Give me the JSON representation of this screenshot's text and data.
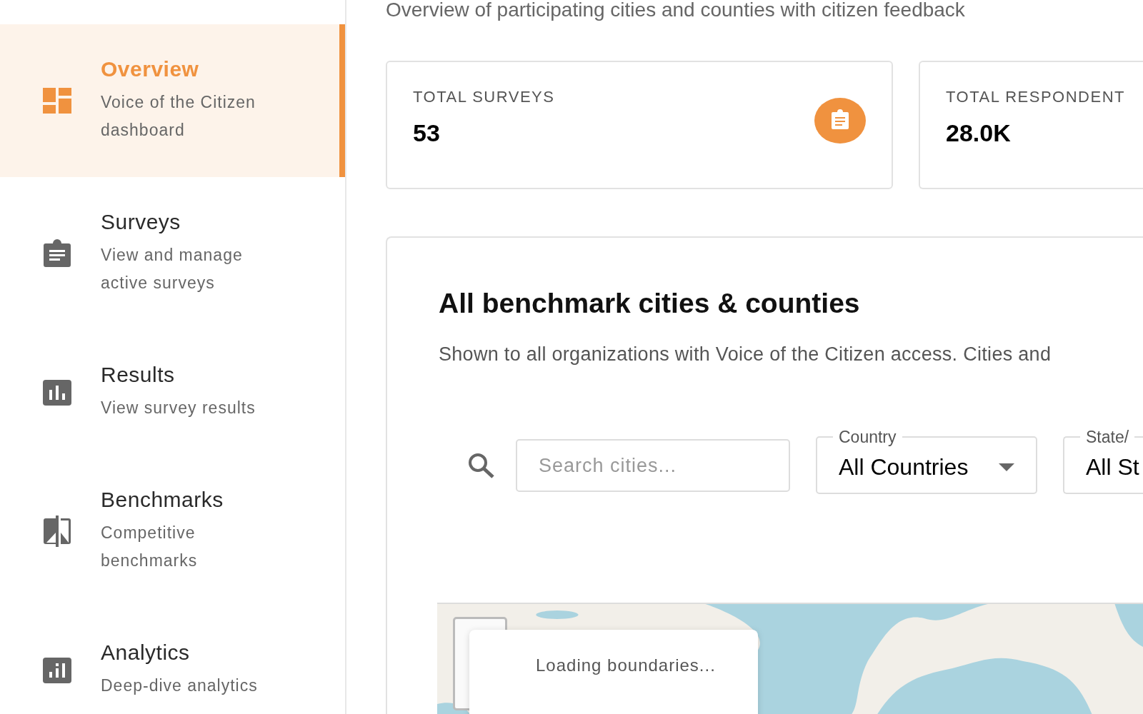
{
  "sidebar": {
    "items": [
      {
        "kind": "dashboard",
        "title": "Overview",
        "subtitle": "Voice of the Citizen dashboard",
        "selected": true
      },
      {
        "kind": "clipboard",
        "title": "Surveys",
        "subtitle": "View and manage active surveys",
        "selected": false
      },
      {
        "kind": "bars",
        "title": "Results",
        "subtitle": "View survey results",
        "selected": false
      },
      {
        "kind": "compare",
        "title": "Benchmarks",
        "subtitle": "Competitive benchmarks",
        "selected": false
      },
      {
        "kind": "analytics",
        "title": "Analytics",
        "subtitle": "Deep-dive analytics",
        "selected": false
      }
    ]
  },
  "page": {
    "subtitle": "Overview of participating cities and counties with citizen feedback"
  },
  "stats": [
    {
      "label": "TOTAL SURVEYS",
      "value": "53",
      "icon": true
    },
    {
      "label": "TOTAL RESPONDENT",
      "value": "28.0K",
      "icon": false
    }
  ],
  "benchmarks": {
    "title": "All benchmark cities & counties",
    "description": "Shown to all organizations with Voice of the Citizen access. Cities and",
    "search": {
      "placeholder": "Search cities..."
    },
    "filters": [
      {
        "label": "Country",
        "value": "All Countries"
      },
      {
        "label": "State/",
        "value": "All St"
      }
    ],
    "map": {
      "kind": "picture",
      "loading": "Loading boundaries..."
    }
  }
}
